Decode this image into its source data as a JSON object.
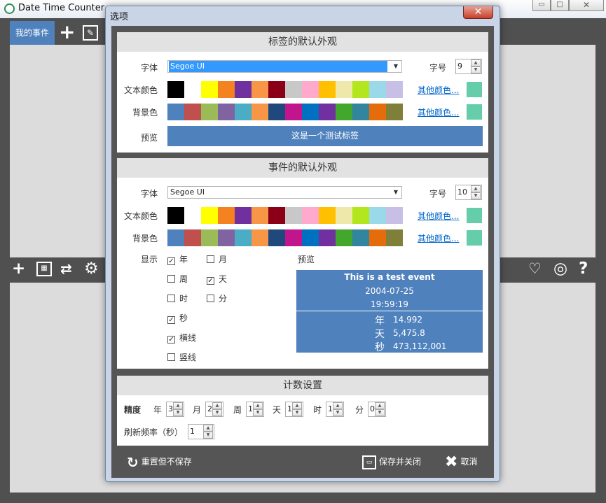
{
  "main_window": {
    "title": "Date Time Counter",
    "tab_label": "我的事件"
  },
  "dialog": {
    "title": "选项",
    "close_glyph": "✕"
  },
  "label_section": {
    "header": "标签的默认外观",
    "font_label": "字体",
    "font_value": "Segoe UI",
    "size_label": "字号",
    "size_value": "9",
    "text_color_label": "文本颜色",
    "bg_color_label": "背景色",
    "more_colors": "其他颜色...",
    "preview_label": "预览",
    "preview_text": "这是一个测试标签",
    "chosen_text_color": "#66cdaa",
    "chosen_bg_color": "#66cdaa"
  },
  "event_section": {
    "header": "事件的默认外观",
    "font_label": "字体",
    "font_value": "Segoe UI",
    "size_label": "字号",
    "size_value": "10",
    "text_color_label": "文本颜色",
    "bg_color_label": "背景色",
    "more_colors": "其他颜色...",
    "display_label": "显示",
    "preview_label": "预览",
    "checkboxes": [
      {
        "label": "年",
        "checked": true
      },
      {
        "label": "月",
        "checked": false
      },
      {
        "label": "周",
        "checked": false
      },
      {
        "label": "天",
        "checked": true
      },
      {
        "label": "时",
        "checked": false
      },
      {
        "label": "分",
        "checked": false
      },
      {
        "label": "秒",
        "checked": true
      },
      {
        "label": "横线",
        "checked": true
      },
      {
        "label": "竖线",
        "checked": false
      }
    ],
    "preview": {
      "title": "This is a test event",
      "date": "2004-07-25",
      "time": "19:59:19",
      "rows": [
        {
          "unit": "年",
          "value": "14.992"
        },
        {
          "unit": "天",
          "value": "5,475.8"
        },
        {
          "unit": "秒",
          "value": "473,112,001"
        }
      ]
    }
  },
  "count_section": {
    "header": "计数设置",
    "precision_label": "精度",
    "fields": [
      {
        "label": "年",
        "value": "3"
      },
      {
        "label": "月",
        "value": "2"
      },
      {
        "label": "周",
        "value": "1"
      },
      {
        "label": "天",
        "value": "1"
      },
      {
        "label": "时",
        "value": "1"
      },
      {
        "label": "分",
        "value": "0"
      }
    ],
    "refresh_label": "刷新频率（秒）",
    "refresh_value": "1"
  },
  "buttons": {
    "reset": "重置但不保存",
    "save_close": "保存并关闭",
    "cancel": "取消"
  },
  "text_palette": [
    "#000000",
    "#ffffff",
    "#ffff00",
    "#f58220",
    "#7030a0",
    "#f79646",
    "#8b0016",
    "#c8c8c8",
    "#ffaacc",
    "#ffc000",
    "#eee8aa",
    "#b4e61e",
    "#99d9ea",
    "#c8bfe7"
  ],
  "bg_palette": [
    "#4f81bd",
    "#c0504d",
    "#9bbb59",
    "#8064a2",
    "#4bacc6",
    "#f79646",
    "#1f497d",
    "#c0158c",
    "#0070c0",
    "#7030a0",
    "#43a62d",
    "#31859c",
    "#e46c0a",
    "#7f7f3a"
  ],
  "preview_color": "#4f81bd"
}
